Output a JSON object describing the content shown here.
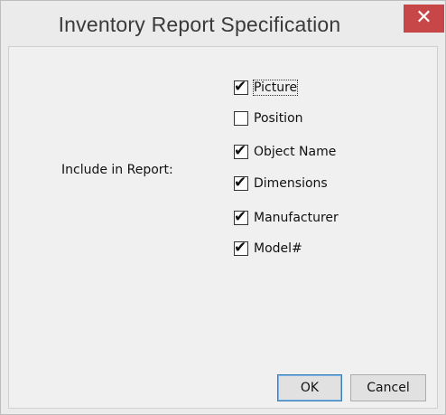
{
  "window": {
    "title": "Inventory Report Specification",
    "close_glyph": "✕"
  },
  "form": {
    "include_label": "Include in Report:",
    "options": [
      {
        "label": "Picture",
        "checked": true,
        "focused": true
      },
      {
        "label": "Position",
        "checked": false,
        "focused": false
      },
      {
        "label": "Object Name",
        "checked": true,
        "focused": false
      },
      {
        "label": "Dimensions",
        "checked": true,
        "focused": false
      },
      {
        "label": "Manufacturer",
        "checked": true,
        "focused": false
      },
      {
        "label": "Model#",
        "checked": true,
        "focused": false
      }
    ],
    "check_glyph": "✔"
  },
  "buttons": {
    "ok": "OK",
    "cancel": "Cancel"
  },
  "colors": {
    "close_button": "#c74748",
    "dialog_background": "#f0f0f0",
    "default_button_border": "#3c7fb1"
  }
}
